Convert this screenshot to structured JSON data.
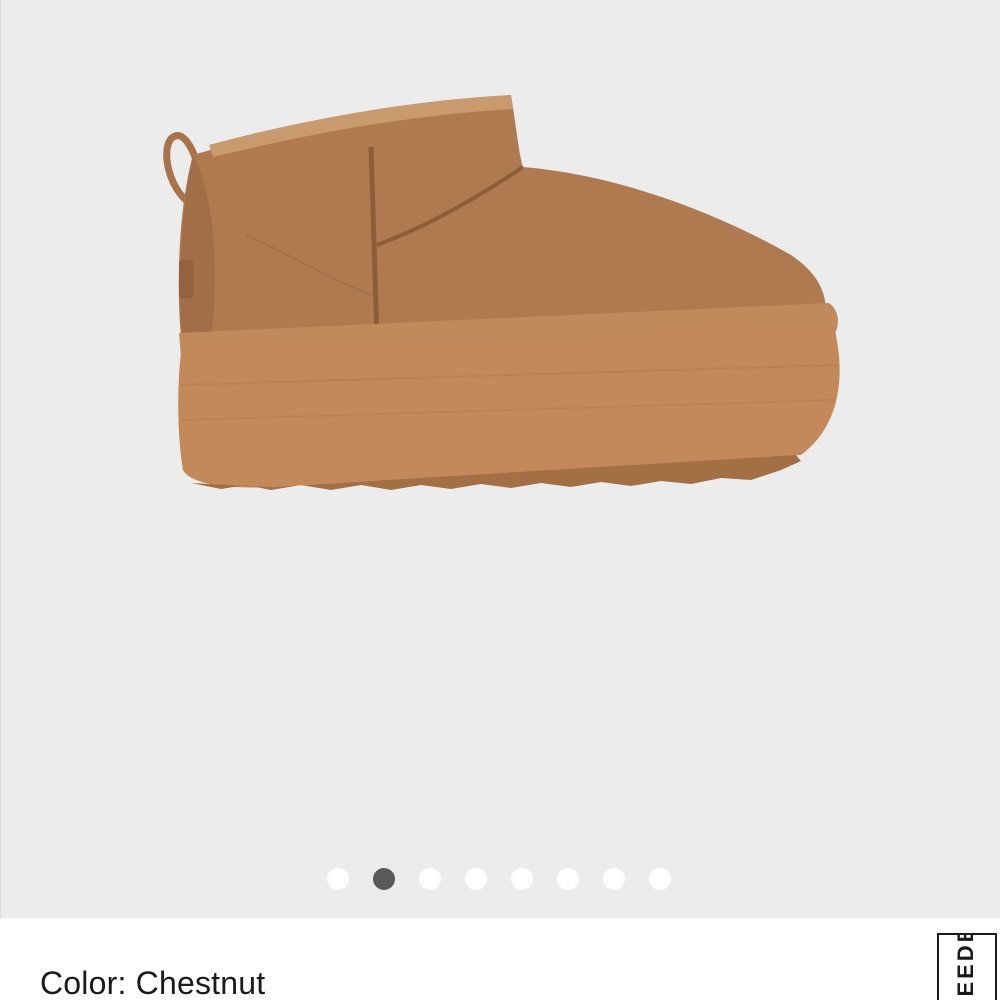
{
  "gallery": {
    "image_alt": "Chestnut suede platform mini boot",
    "dots": [
      {
        "active": false
      },
      {
        "active": true
      },
      {
        "active": false
      },
      {
        "active": false
      },
      {
        "active": false
      },
      {
        "active": false
      },
      {
        "active": false
      },
      {
        "active": false
      }
    ],
    "background_color": "#ececed",
    "active_dot_color": "#595959"
  },
  "product": {
    "color_label": "Color: Chestnut"
  },
  "feedback_tab": {
    "label": "FEEDBACK"
  }
}
